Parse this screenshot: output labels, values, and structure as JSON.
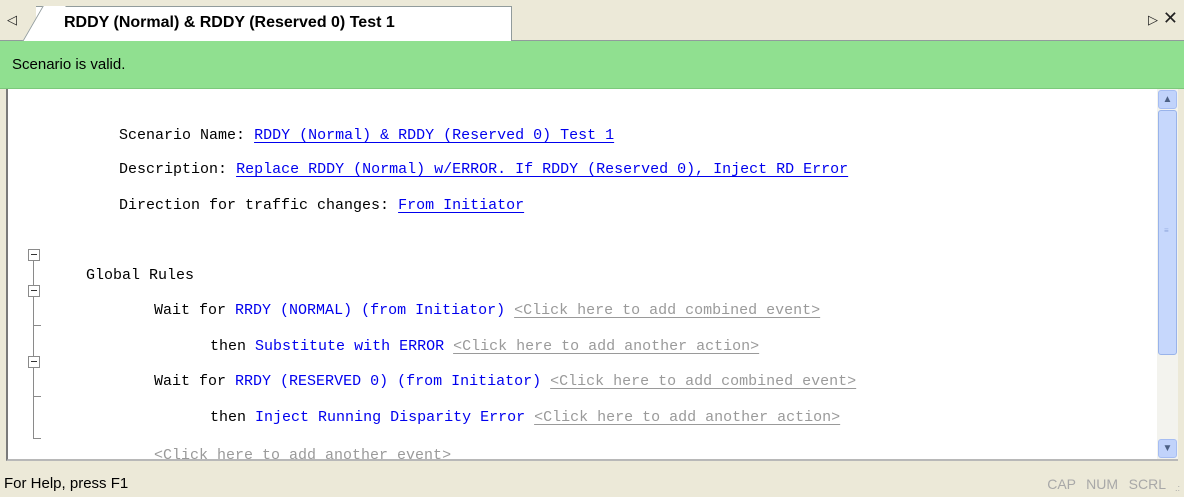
{
  "tab": {
    "title": "RDDY (Normal) & RDDY (Reserved 0) Test 1"
  },
  "banner": {
    "message": "Scenario is valid."
  },
  "scenario": {
    "name_label": "Scenario Name:",
    "name_value": "RDDY (Normal) & RDDY (Reserved 0) Test 1",
    "description_label": "Description:",
    "description_value": "Replace RDDY (Normal) w/ERROR. If RDDY (Reserved 0), Inject RD Error",
    "direction_label": "Direction for traffic changes:",
    "direction_value": "From Initiator"
  },
  "rules": {
    "heading": "Global Rules",
    "events": [
      {
        "wait_label": "Wait for",
        "event": "RRDY (NORMAL) (from Initiator)",
        "add_combined_hint": "<Click here to add combined event>",
        "then_label": "then",
        "action": "Substitute with ERROR",
        "add_action_hint": "<Click here to add another action>"
      },
      {
        "wait_label": "Wait for",
        "event": "RRDY (RESERVED 0) (from Initiator)",
        "add_combined_hint": "<Click here to add combined event>",
        "then_label": "then",
        "action": "Inject Running Disparity Error",
        "add_action_hint": "<Click here to add another action>"
      }
    ],
    "add_event_hint": "<Click here to add another event>"
  },
  "statusbar": {
    "help": "For Help, press F1",
    "indicators": [
      "CAP",
      "NUM",
      "SCRL"
    ]
  },
  "icons": {
    "nav_left": "tab-scroll-left-icon",
    "nav_right": "tab-scroll-right-icon",
    "close": "close-icon"
  },
  "colors": {
    "banner": "#90e090",
    "link": "#0000ee",
    "hint": "#9a9a9a"
  }
}
